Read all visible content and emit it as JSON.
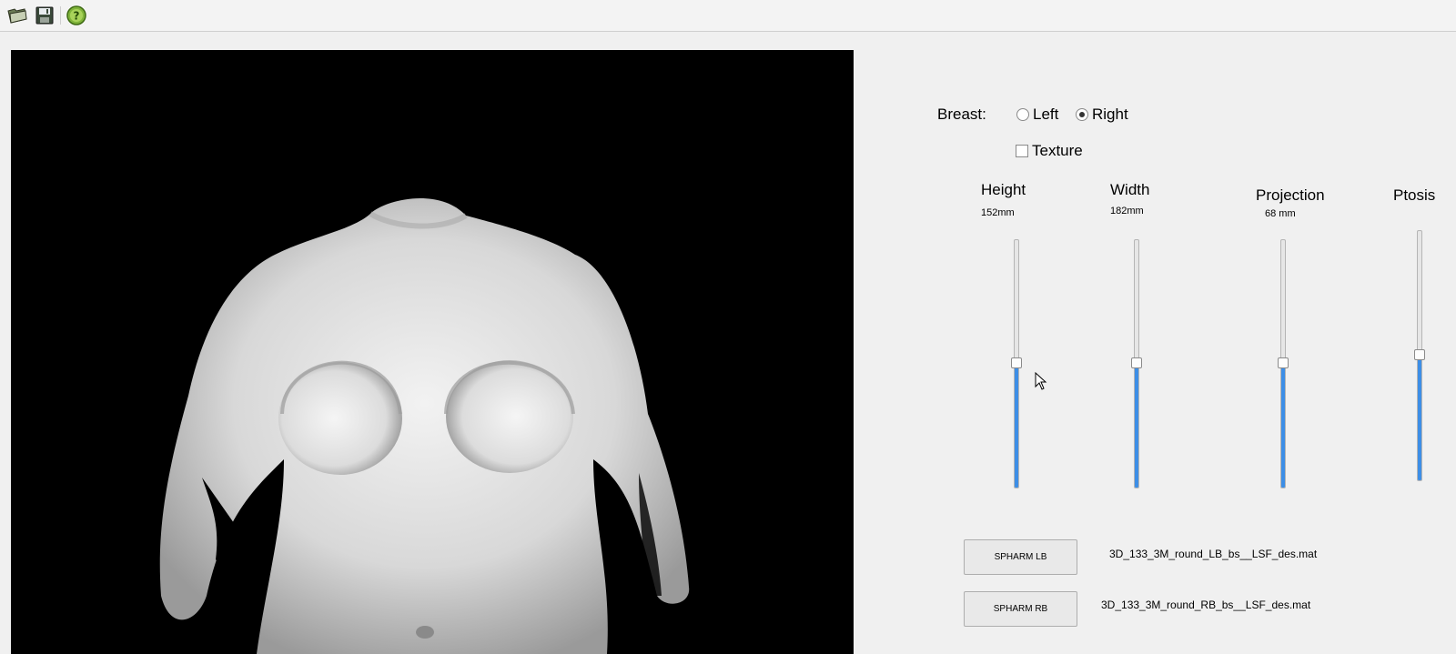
{
  "toolbar": {
    "icons": [
      "open-folder-icon",
      "save-icon",
      "help-icon"
    ]
  },
  "breast_selector": {
    "label": "Breast:",
    "options": [
      {
        "label": "Left",
        "checked": false
      },
      {
        "label": "Right",
        "checked": true
      }
    ]
  },
  "texture": {
    "label": "Texture",
    "checked": false
  },
  "sliders": [
    {
      "title": "Height",
      "value_text": "152mm",
      "level": 0.5
    },
    {
      "title": "Width",
      "value_text": "182mm",
      "level": 0.5
    },
    {
      "title": "Projection",
      "value_text": "68 mm",
      "level": 0.5
    },
    {
      "title": "Ptosis",
      "value_text": "",
      "level": 0.5
    }
  ],
  "files": [
    {
      "button_label": "SPHARM LB",
      "file_name": "3D_133_3M_round_LB_bs__LSF_des.mat"
    },
    {
      "button_label": "SPHARM RB",
      "file_name": "3D_133_3M_round_RB_bs__LSF_des.mat"
    }
  ],
  "colors": {
    "accent": "#3d8ee6",
    "viewport_bg": "#000000"
  }
}
